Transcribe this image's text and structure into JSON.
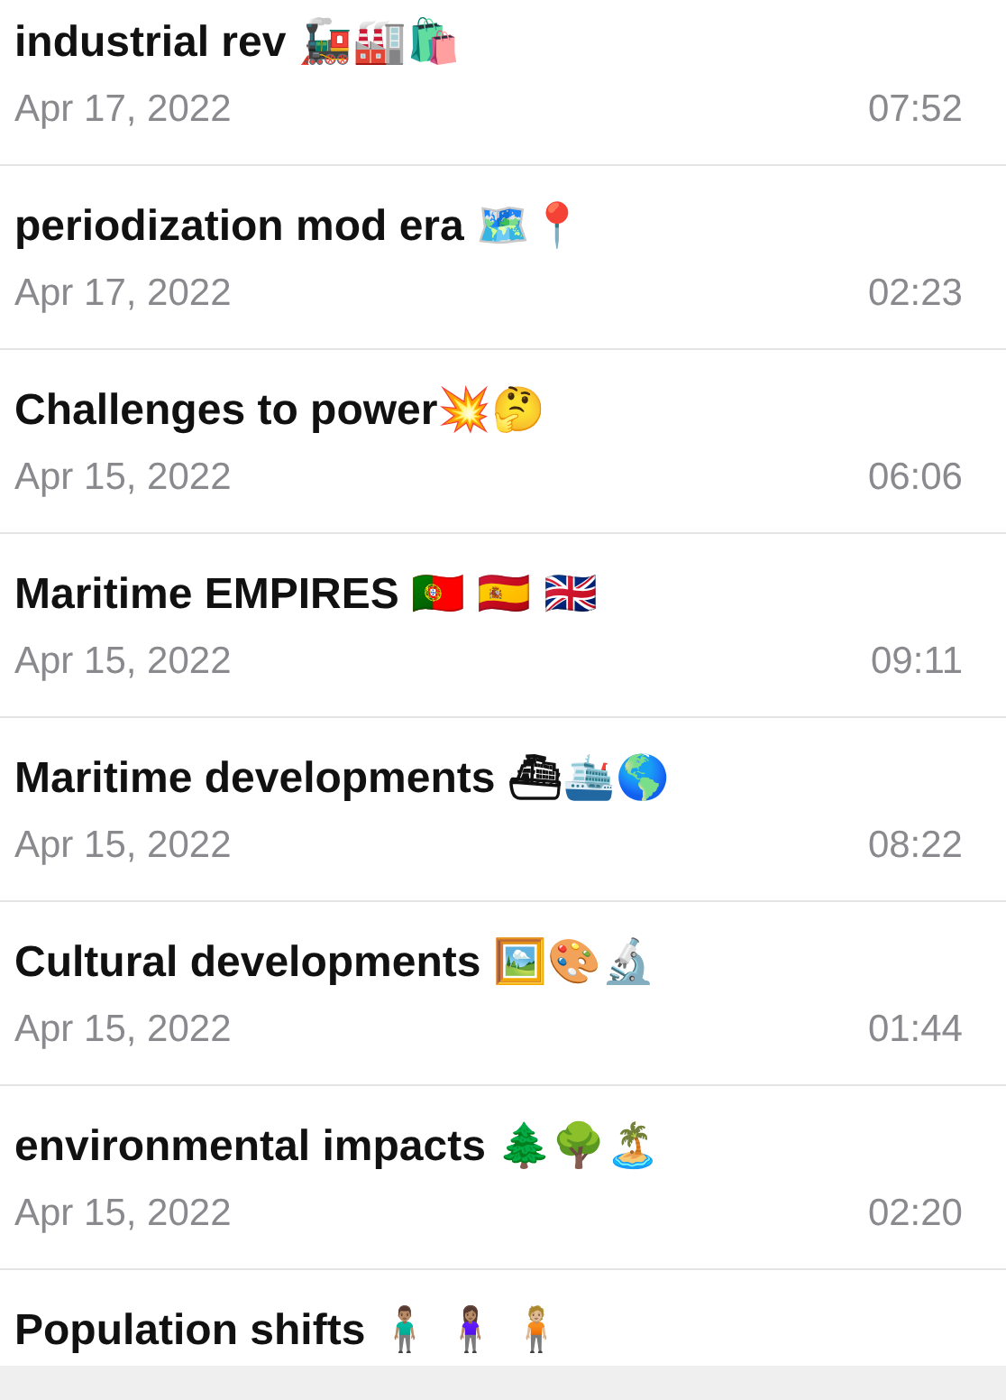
{
  "memos": [
    {
      "title": "industrial rev 🚂🏭🛍️",
      "date": "Apr 17, 2022",
      "duration": "07:52"
    },
    {
      "title": "periodization mod era 🗺️📍",
      "date": "Apr 17, 2022",
      "duration": "02:23"
    },
    {
      "title": "Challenges to power💥🤔",
      "date": "Apr 15, 2022",
      "duration": "06:06"
    },
    {
      "title": "Maritime EMPIRES 🇵🇹 🇪🇸 🇬🇧",
      "date": "Apr 15, 2022",
      "duration": "09:11"
    },
    {
      "title": "Maritime developments ⛴🛳️🌎",
      "date": "Apr 15, 2022",
      "duration": "08:22"
    },
    {
      "title": "Cultural developments 🖼️🎨🔬",
      "date": "Apr 15, 2022",
      "duration": "01:44"
    },
    {
      "title": "environmental impacts 🌲🌳🏝️",
      "date": "Apr 15, 2022",
      "duration": "02:20"
    },
    {
      "title": "Population shifts 🧍🏽‍♂️ 🧍🏽‍♀️ 🧍🏼"
    }
  ]
}
